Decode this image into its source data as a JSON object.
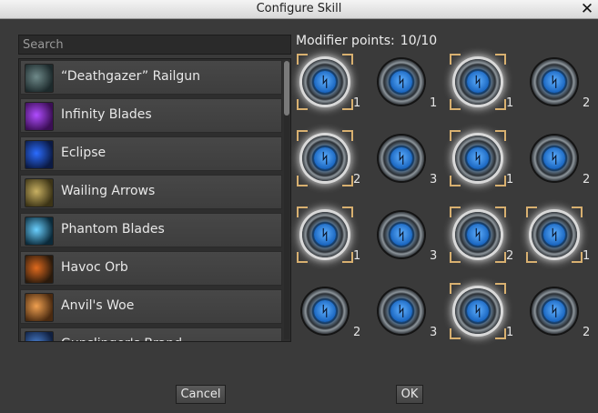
{
  "window": {
    "title": "Configure Skill",
    "close_glyph": "✕"
  },
  "search": {
    "placeholder": "Search",
    "value": ""
  },
  "skills": [
    {
      "label": "“Deathgazer” Railgun",
      "icon": "railgun-icon",
      "colors": [
        "#1d2a2c",
        "#6f8a8a"
      ]
    },
    {
      "label": "Infinity Blades",
      "icon": "infinity-blades-icon",
      "colors": [
        "#3b0e55",
        "#b04cff"
      ]
    },
    {
      "label": "Eclipse",
      "icon": "eclipse-icon",
      "colors": [
        "#0b1a44",
        "#2b6cff"
      ]
    },
    {
      "label": "Wailing Arrows",
      "icon": "wailing-arrows-icon",
      "colors": [
        "#3c3416",
        "#c8b062"
      ]
    },
    {
      "label": "Phantom Blades",
      "icon": "phantom-blades-icon",
      "colors": [
        "#0b2a3a",
        "#6ad0ff"
      ]
    },
    {
      "label": "Havoc Orb",
      "icon": "havoc-orb-icon",
      "colors": [
        "#2a1a0c",
        "#e06a1e"
      ]
    },
    {
      "label": "Anvil's Woe",
      "icon": "anvils-woe-icon",
      "colors": [
        "#4a2a10",
        "#f0a050"
      ]
    },
    {
      "label": "Gunslinger's Brand",
      "icon": "gunslingers-brand-icon",
      "colors": [
        "#102040",
        "#4a80d0"
      ]
    }
  ],
  "scroll_fraction": 0.0,
  "modifier_points": {
    "label": "Modifier points:",
    "value": "10/10"
  },
  "modifiers": [
    {
      "count": "1",
      "selected": true
    },
    {
      "count": "1",
      "selected": false
    },
    {
      "count": "1",
      "selected": true
    },
    {
      "count": "2",
      "selected": false
    },
    {
      "count": "2",
      "selected": true
    },
    {
      "count": "3",
      "selected": false
    },
    {
      "count": "1",
      "selected": true
    },
    {
      "count": "2",
      "selected": false
    },
    {
      "count": "1",
      "selected": true
    },
    {
      "count": "3",
      "selected": false
    },
    {
      "count": "2",
      "selected": true
    },
    {
      "count": "1",
      "selected": true
    },
    {
      "count": "2",
      "selected": false
    },
    {
      "count": "3",
      "selected": false
    },
    {
      "count": "1",
      "selected": true
    },
    {
      "count": "2",
      "selected": false
    }
  ],
  "modifier_icon": "rune-orb-icon",
  "modifier_rune": "ᛋ",
  "buttons": {
    "cancel": "Cancel",
    "ok": "OK"
  }
}
